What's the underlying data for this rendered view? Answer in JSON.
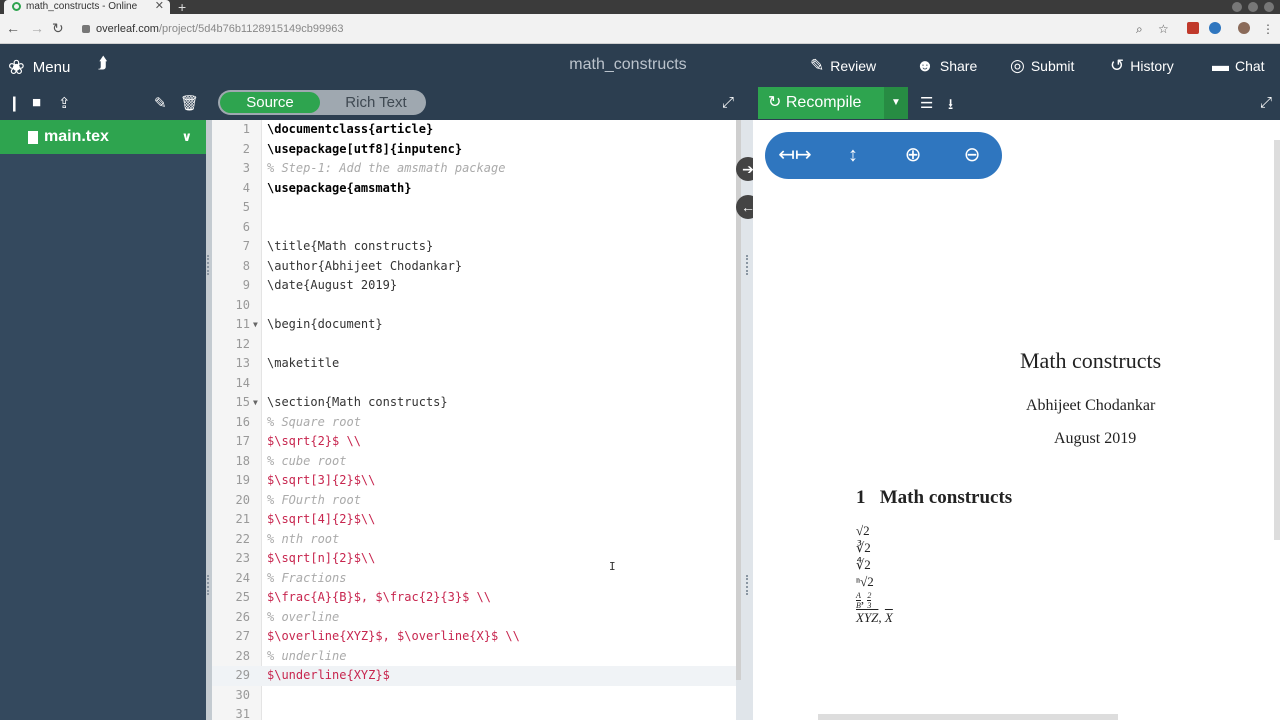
{
  "browser": {
    "tab_title": "math_constructs - Online",
    "url_host": "overleaf.com",
    "url_path": "/project/5d4b76b1128915149cb99963"
  },
  "app": {
    "menu_label": "Menu",
    "project_title": "math_constructs",
    "review_label": "Review",
    "share_label": "Share",
    "submit_label": "Submit",
    "history_label": "History",
    "chat_label": "Chat"
  },
  "editor_toggle": {
    "source": "Source",
    "rich_text": "Rich Text"
  },
  "recompile_label": "Recompile",
  "files": [
    {
      "name": "main.tex",
      "selected": true
    }
  ],
  "code_lines": [
    {
      "n": "1",
      "text": "\\documentclass{article}"
    },
    {
      "n": "2",
      "text": "\\usepackage[utf8]{inputenc}"
    },
    {
      "n": "3",
      "text": "% Step-1: Add the amsmath package"
    },
    {
      "n": "4",
      "text": "\\usepackage{amsmath}"
    },
    {
      "n": "5",
      "text": ""
    },
    {
      "n": "6",
      "text": ""
    },
    {
      "n": "7",
      "text": "\\title{Math constructs}"
    },
    {
      "n": "8",
      "text": "\\author{Abhijeet Chodankar}"
    },
    {
      "n": "9",
      "text": "\\date{August 2019}"
    },
    {
      "n": "10",
      "text": ""
    },
    {
      "n": "11",
      "text": "\\begin{document}"
    },
    {
      "n": "12",
      "text": ""
    },
    {
      "n": "13",
      "text": "\\maketitle"
    },
    {
      "n": "14",
      "text": ""
    },
    {
      "n": "15",
      "text": "\\section{Math constructs}"
    },
    {
      "n": "16",
      "text": "% Square root"
    },
    {
      "n": "17",
      "text": "$\\sqrt{2}$ \\\\"
    },
    {
      "n": "18",
      "text": "% cube root"
    },
    {
      "n": "19",
      "text": "$\\sqrt[3]{2}$\\\\"
    },
    {
      "n": "20",
      "text": "% FOurth root"
    },
    {
      "n": "21",
      "text": "$\\sqrt[4]{2}$\\\\"
    },
    {
      "n": "22",
      "text": "% nth root"
    },
    {
      "n": "23",
      "text": "$\\sqrt[n]{2}$\\\\"
    },
    {
      "n": "24",
      "text": "% Fractions"
    },
    {
      "n": "25",
      "text": "$\\frac{A}{B}$, $\\frac{2}{3}$ \\\\"
    },
    {
      "n": "26",
      "text": "% overline"
    },
    {
      "n": "27",
      "text": "$\\overline{XYZ}$, $\\overline{X}$ \\\\"
    },
    {
      "n": "28",
      "text": "% underline"
    },
    {
      "n": "29",
      "text": "$\\underline{XYZ}$"
    },
    {
      "n": "30",
      "text": ""
    },
    {
      "n": "31",
      "text": ""
    }
  ],
  "pdf": {
    "title": "Math constructs",
    "author": "Abhijeet Chodankar",
    "date": "August 2019",
    "section_number": "1",
    "section_title": "Math constructs",
    "sqrt2": "√2",
    "cbrt2": "∛2",
    "fourth2": "∜2",
    "nth2": "ⁿ√2",
    "frac1_num": "A",
    "frac1_den": "B",
    "frac2_num": "2",
    "frac2_den": "3",
    "overline1": "XYZ",
    "overline2": "X"
  }
}
